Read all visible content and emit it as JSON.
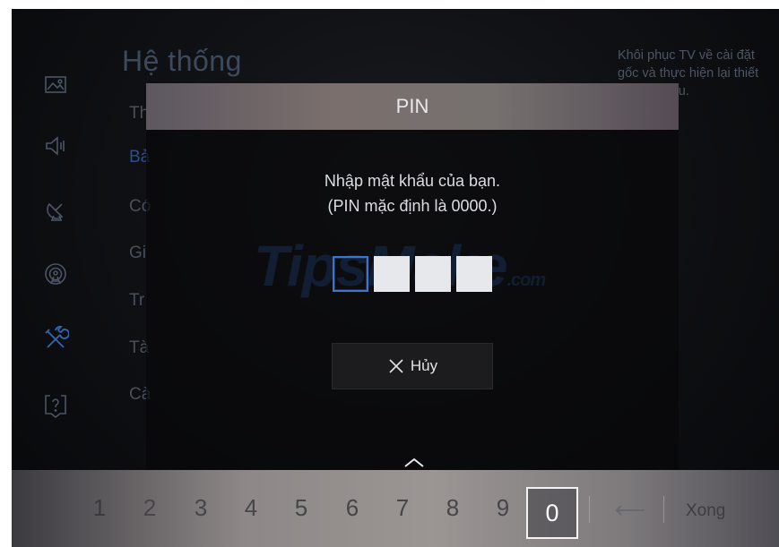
{
  "background": {
    "title": "Hệ thống",
    "menu_items": [
      "Thời gian",
      "Bả",
      "Có",
      "Gi",
      "Tr",
      "Tà",
      "Cà"
    ],
    "help_text": "Khôi phục TV về cài đặt gốc và thực hiện lại thiết lập ban đầu.",
    "sidebar_icons": [
      "picture-icon",
      "sound-icon",
      "broadcast-icon",
      "network-icon",
      "tools-icon",
      "support-icon"
    ]
  },
  "dialog": {
    "title": "PIN",
    "prompt_line1": "Nhập mật khẩu của bạn.",
    "prompt_line2": "(PIN mặc định là 0000.)",
    "pin_slots": 4,
    "pin_entered": 0,
    "cancel_label": "Hủy"
  },
  "watermark": {
    "text": "TipsMake",
    "suffix": ".com"
  },
  "keypad": {
    "digits": [
      "1",
      "2",
      "3",
      "4",
      "5",
      "6",
      "7",
      "8",
      "9",
      "0"
    ],
    "selected": "0",
    "done_label": "Xong"
  },
  "colors": {
    "accent": "#3a76cf",
    "dialog_header": "#76716f"
  }
}
